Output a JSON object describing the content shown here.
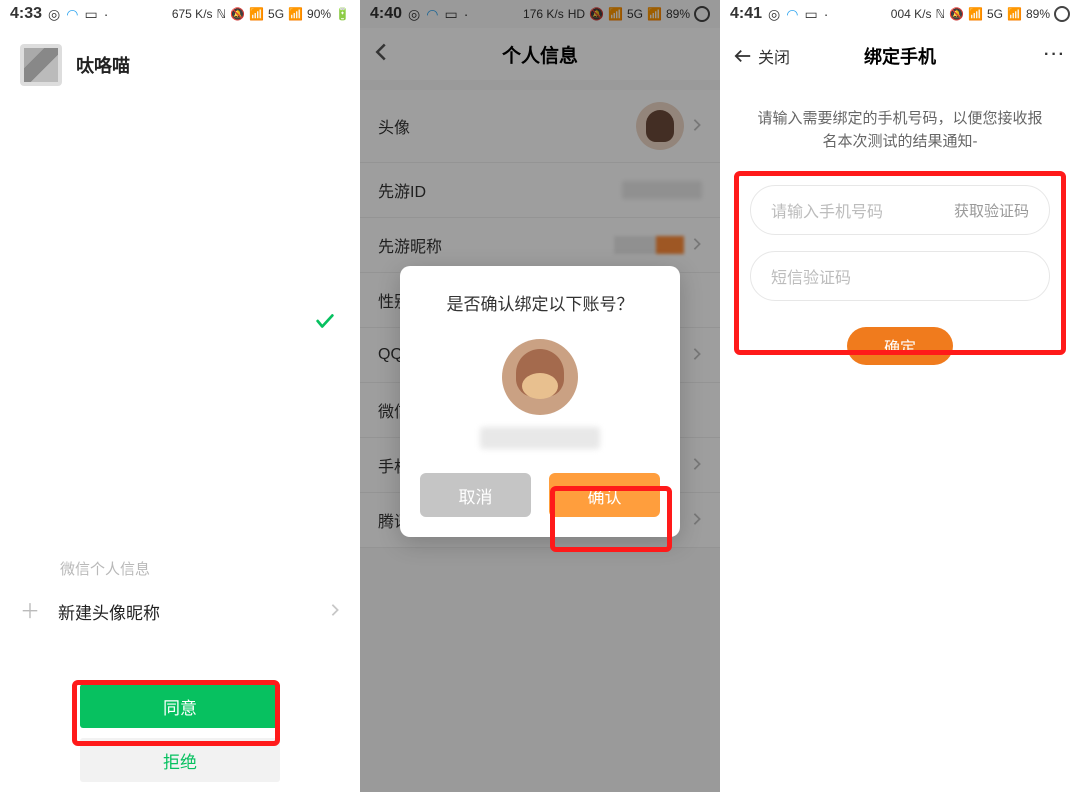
{
  "phone1": {
    "status": {
      "time": "4:33",
      "net": "675 K/s",
      "battery": "90%"
    },
    "profile_name": "呔咯喵",
    "section_label": "微信个人信息",
    "new_avatar_label": "新建头像昵称",
    "agree": "同意",
    "reject": "拒绝"
  },
  "phone2": {
    "status": {
      "time": "4:40",
      "net": "176 K/s",
      "battery": "89%"
    },
    "title": "个人信息",
    "rows": {
      "avatar": "头像",
      "xy_id": "先游ID",
      "xy_nick": "先游昵称",
      "gender": "性别",
      "qq": "QQ",
      "wechat": "微信",
      "phone": "手机",
      "tencent": "腾讯"
    },
    "dialog": {
      "title": "是否确认绑定以下账号？",
      "cancel": "取消",
      "ok": "确认"
    }
  },
  "phone3": {
    "status": {
      "time": "4:41",
      "net": "004 K/s",
      "battery": "89%"
    },
    "close": "关闭",
    "title": "绑定手机",
    "desc": "请输入需要绑定的手机号码，以便您接收报名本次测试的结果通知-",
    "phone_placeholder": "请输入手机号码",
    "get_code": "获取验证码",
    "sms_placeholder": "短信验证码",
    "submit": "确定"
  }
}
